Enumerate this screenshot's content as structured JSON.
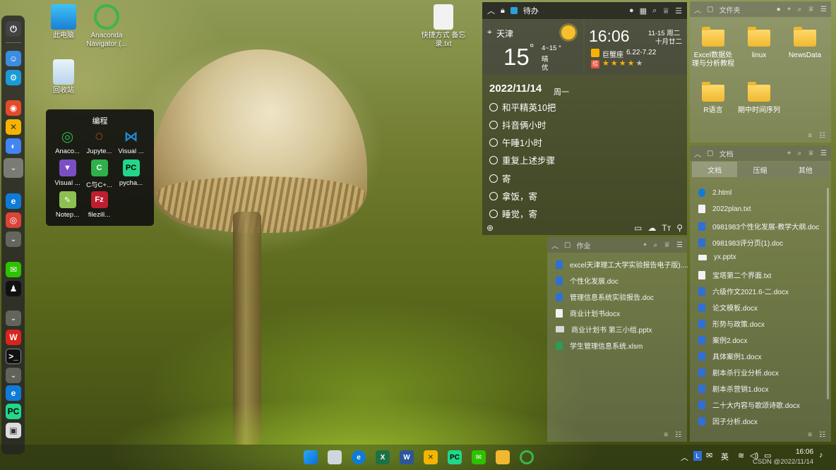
{
  "desktop": {
    "icons": [
      {
        "label": "此电脑"
      },
      {
        "label": "Anaconda Navigator (..."
      },
      {
        "label": "快捷方式 备忘录.txt"
      },
      {
        "label": "回收站"
      }
    ]
  },
  "popup": {
    "title": "编程",
    "apps": [
      {
        "label": "Anaco...",
        "glyph": "◎",
        "color": "#2fb04a"
      },
      {
        "label": "Jupyte...",
        "glyph": "◌",
        "color": "#f37726"
      },
      {
        "label": "Visual ...",
        "glyph": "⋈",
        "color": "#1f8ad2"
      },
      {
        "label": "Visual ...",
        "glyph": "▼",
        "color": "#7b4fc4"
      },
      {
        "label": "C与C+...",
        "glyph": "C",
        "color": "#2fb04a"
      },
      {
        "label": "pycha...",
        "glyph": "PC",
        "color": "#21d789"
      },
      {
        "label": "Notep...",
        "glyph": "✎",
        "color": "#8cc152"
      },
      {
        "label": "filezill...",
        "glyph": "Fz",
        "color": "#bf1e2e"
      }
    ]
  },
  "todo": {
    "title": "待办",
    "city": "天津",
    "temp": "15",
    "temp_unit": "°",
    "range": "4~15 °",
    "cond": "晴",
    "aqi": "优",
    "time": "16:06",
    "date_short": "11-15 周二",
    "lunar": "十月廿二",
    "zodiac_badge": "巨蟹座",
    "zodiac_range": "6.22-7.22",
    "fortune_badge": "综",
    "big_date": "2022/11/14",
    "week": "周一",
    "tasks": [
      "和平精英10把",
      "抖音俩小时",
      "午睡1小时",
      "重复上述步骤",
      "寄",
      "拿饭，寄",
      "睡觉，寄"
    ]
  },
  "files_fence": {
    "title": "文件夹",
    "folders": [
      "Excel数据处理与分析教程",
      "linux",
      "NewsData",
      "R语言",
      "期中时间序列"
    ]
  },
  "work_fence": {
    "title": "作业",
    "files": [
      "excel天津理工大学实验报告电子版)....",
      "个性化发展.doc",
      "管理信息系统实验报告.doc",
      "商业计划书docx",
      "商业计划书 第三小组.pptx",
      "学生管理信息系统.xlsm"
    ]
  },
  "docs_fence": {
    "title": "文档",
    "tabs": [
      "文档",
      "压缩",
      "其他"
    ],
    "files": [
      "2.html",
      "2022plan.txt",
      "0981983个性化发展-教学大纲.doc",
      "0981983评分页(1).doc",
      "yx.pptx",
      "宝塔第二个界面.txt",
      "六级作文2021.6-二.docx",
      "论文模板.docx",
      "形势与政策.docx",
      "案例2.docx",
      "具体案例1.docx",
      "剧本杀行业分析.docx",
      "剧本杀营销1.docx",
      "二十大内容与歌颂诗歌.docx",
      "因子分析.docx"
    ]
  },
  "taskbar": {
    "ime": "英",
    "time": "16:06",
    "watermark": "CSDN @2022/11/14"
  },
  "colors": {
    "accent": "#2f6fd6",
    "folder": "#f0b830"
  }
}
